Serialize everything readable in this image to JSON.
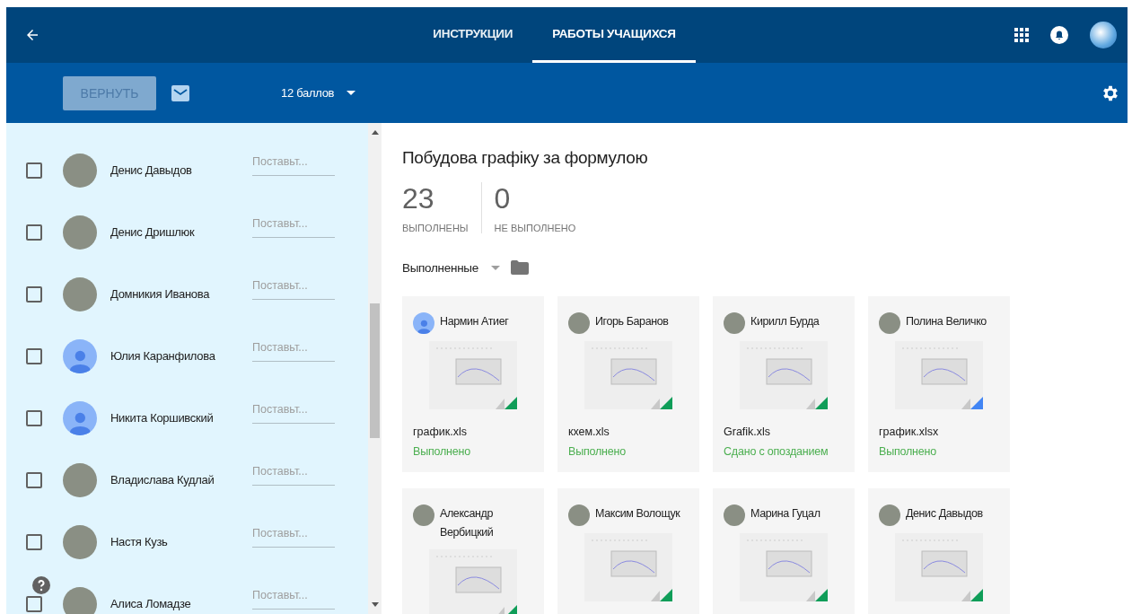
{
  "topbar": {
    "tabs": [
      {
        "label": "ИНСТРУКЦИИ",
        "selected": false
      },
      {
        "label": "РАБОТЫ УЧАЩИХСЯ",
        "selected": true
      }
    ]
  },
  "toolbar": {
    "return_button": {
      "label": "ВЕРНУТЬ",
      "disabled": true
    },
    "points": "12 баллов"
  },
  "students": [
    {
      "name": "Денис Давыдов",
      "photo": true,
      "placeholder": "Поставьт...",
      "checked": false
    },
    {
      "name": "Денис Дришлюк",
      "photo": true,
      "placeholder": "Поставьт...",
      "checked": false
    },
    {
      "name": "Домникия Иванова",
      "photo": true,
      "placeholder": "Поставьт...",
      "checked": false
    },
    {
      "name": "Юлия Каранфилова",
      "photo": false,
      "placeholder": "Поставьт...",
      "checked": false
    },
    {
      "name": "Никита Коршивский",
      "photo": false,
      "placeholder": "Поставьт...",
      "checked": false
    },
    {
      "name": "Владислава Кудлай",
      "photo": true,
      "placeholder": "Поставьт...",
      "checked": false
    },
    {
      "name": "Настя Кузь",
      "photo": true,
      "placeholder": "Поставьт...",
      "checked": false
    },
    {
      "name": "Алиса Ломадзе",
      "photo": true,
      "placeholder": "Поставьт...",
      "checked": false
    }
  ],
  "assignment": {
    "title": "Побудова графіку за формулою",
    "stats": [
      {
        "value": "23",
        "label": "ВЫПОЛНЕНЫ"
      },
      {
        "value": "0",
        "label": "НЕ ВЫПОЛНЕНО"
      }
    ],
    "filter": "Выполненные"
  },
  "submissions": [
    {
      "student": "Нармин Атиег",
      "photo": false,
      "file": "график.xls",
      "status": "Выполнено",
      "color": "#0f9d58"
    },
    {
      "student": "Игорь Баранов",
      "photo": true,
      "file": "кхем.xls",
      "status": "Выполнено",
      "color": "#0f9d58"
    },
    {
      "student": "Кирилл Бурда",
      "photo": true,
      "file": "Grafik.xls",
      "status": "Сдано с опозданием",
      "color": "#0f9d58"
    },
    {
      "student": "Полина Величко",
      "photo": true,
      "file": "график.xlsx",
      "status": "Выполнено",
      "color": "#4285f4"
    },
    {
      "student": "Александр Вербицкий",
      "photo": true,
      "color": "#0f9d58"
    },
    {
      "student": "Максим Волощук",
      "photo": true,
      "color": "#0f9d58"
    },
    {
      "student": "Марина Гуцал",
      "photo": true,
      "color": "#0f9d58"
    },
    {
      "student": "Денис Давыдов",
      "photo": true,
      "color": "#0f9d58"
    }
  ]
}
